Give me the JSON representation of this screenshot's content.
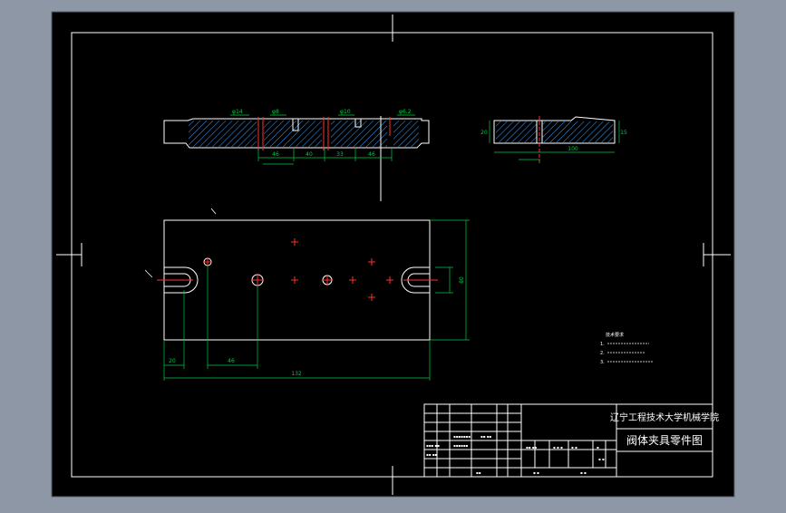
{
  "drawing": {
    "title_block": {
      "school": "辽宁工程技术大学机械学院",
      "part_name": "阀体夹具零件图"
    },
    "dimensions": {
      "total_length": "132",
      "left_offset": "20",
      "hole_spacing": "46",
      "height": "80",
      "side_length": "100",
      "side_height_left": "20",
      "side_height_right": "15",
      "top_seg_1": "46",
      "top_seg_2": "40",
      "top_seg_3": "33",
      "top_seg_4": "46",
      "dia_1": "φ14",
      "dia_2": "φ8",
      "dia_3": "φ10",
      "dia_4": "φ6.2"
    },
    "tech_notes": {
      "heading": "技术要求",
      "line1": "1.",
      "line2": "2.",
      "line3": "3."
    }
  },
  "colors": {
    "background": "#000000",
    "line": "#ffffff",
    "dimension": "#00cc44",
    "hatch": "#3aa0ff",
    "center": "#ff3030",
    "frame": "#8e97a6"
  }
}
